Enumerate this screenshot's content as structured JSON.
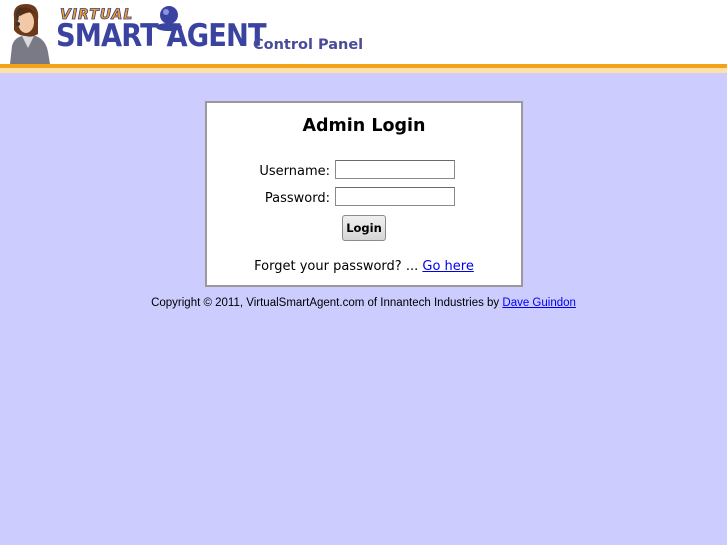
{
  "header": {
    "logo_top": "VIRTUAL",
    "logo_main": "SMART AGENT",
    "title": "Control Panel"
  },
  "login": {
    "title": "Admin Login",
    "username_label": "Username:",
    "username_value": "",
    "password_label": "Password:",
    "password_value": "",
    "button_label": "Login",
    "forgot_text": "Forget your password? ...",
    "forgot_link": "Go here"
  },
  "footer": {
    "copyright_text": "Copyright © 2011, VirtualSmartAgent.com of Innantech Industries by",
    "author_link": "Dave Guindon"
  },
  "colors": {
    "background": "#ccccff",
    "accent_orange": "#f5a21b",
    "logo_blue": "#3a44a0",
    "link": "#0000ee"
  }
}
